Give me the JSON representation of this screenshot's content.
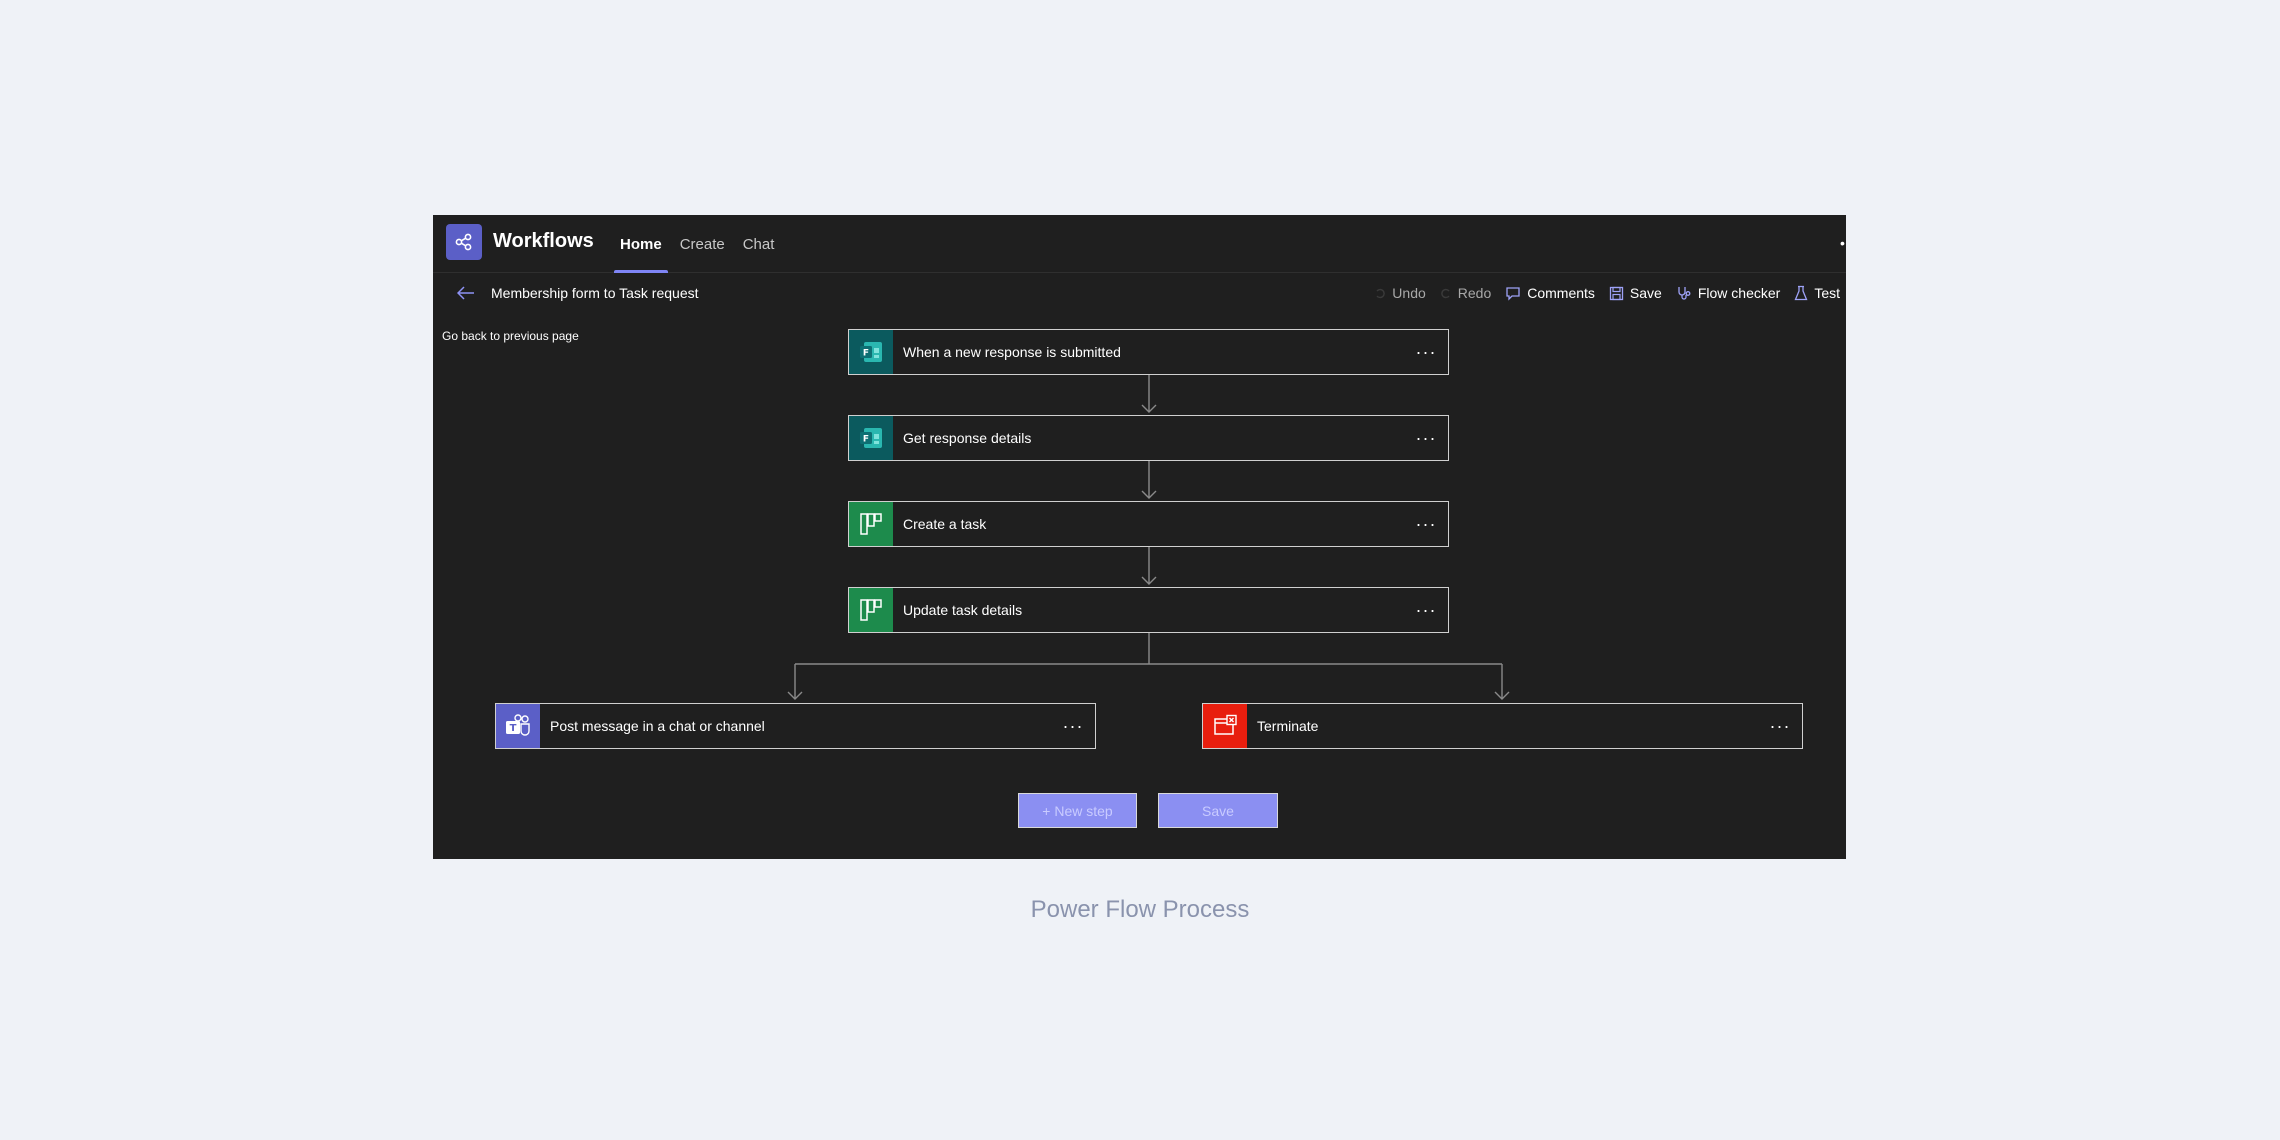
{
  "header": {
    "app_title": "Workflows",
    "tabs": [
      {
        "label": "Home",
        "active": true
      },
      {
        "label": "Create",
        "active": false
      },
      {
        "label": "Chat",
        "active": false
      }
    ]
  },
  "subheader": {
    "flow_title": "Membership form to Task request",
    "back_tooltip": "Go back to previous page"
  },
  "toolbar": {
    "undo": "Undo",
    "redo": "Redo",
    "comments": "Comments",
    "save": "Save",
    "flow_checker": "Flow checker",
    "test": "Test"
  },
  "flow": {
    "steps": [
      {
        "label": "When a new response is submitted",
        "icon": "forms-icon",
        "color": "#0b5a5e"
      },
      {
        "label": "Get response details",
        "icon": "forms-icon",
        "color": "#0b5a5e"
      },
      {
        "label": "Create a task",
        "icon": "planner-icon",
        "color": "#1d8b4c"
      },
      {
        "label": "Update task details",
        "icon": "planner-icon",
        "color": "#1d8b4c"
      }
    ],
    "branches": [
      {
        "label": "Post message in a chat or channel",
        "icon": "teams-icon",
        "color": "#5b5fc7"
      },
      {
        "label": "Terminate",
        "icon": "terminate-icon",
        "color": "#e81e0e"
      }
    ],
    "more_label": "···"
  },
  "actions": {
    "new_step": "+ New step",
    "save": "Save"
  },
  "caption": "Power Flow  Process",
  "colors": {
    "accent": "#5b5fc7",
    "tab_indicator": "#7f85f5",
    "button_fill": "#8b8ff2"
  }
}
